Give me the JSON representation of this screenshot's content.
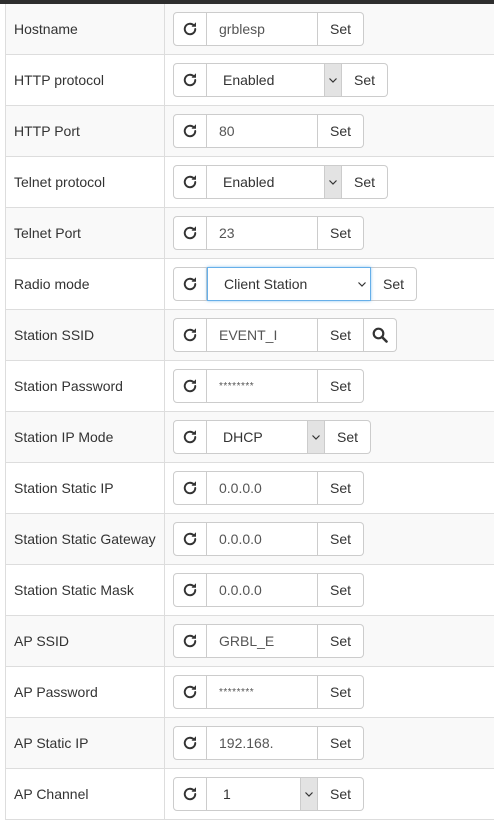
{
  "rows": [
    {
      "label": "Hostname",
      "type": "text",
      "value": "grblesp",
      "set": "Set"
    },
    {
      "label": "HTTP protocol",
      "type": "select",
      "value": "Enabled",
      "set": "Set"
    },
    {
      "label": "HTTP Port",
      "type": "text",
      "value": "80",
      "set": "Set"
    },
    {
      "label": "Telnet protocol",
      "type": "select",
      "value": "Enabled",
      "set": "Set"
    },
    {
      "label": "Telnet Port",
      "type": "text",
      "value": "23",
      "set": "Set"
    },
    {
      "label": "Radio mode",
      "type": "select",
      "value": "Client Station",
      "set": "Set"
    },
    {
      "label": "Station SSID",
      "type": "text",
      "value": "EVENT_I",
      "set": "Set"
    },
    {
      "label": "Station Password",
      "type": "password",
      "value": "********",
      "set": "Set"
    },
    {
      "label": "Station IP Mode",
      "type": "select",
      "value": "DHCP",
      "set": "Set"
    },
    {
      "label": "Station Static IP",
      "type": "text",
      "value": "0.0.0.0",
      "set": "Set"
    },
    {
      "label": "Station Static Gateway",
      "type": "text",
      "value": "0.0.0.0",
      "set": "Set"
    },
    {
      "label": "Station Static Mask",
      "type": "text",
      "value": "0.0.0.0",
      "set": "Set"
    },
    {
      "label": "AP SSID",
      "type": "text",
      "value": "GRBL_E",
      "set": "Set"
    },
    {
      "label": "AP Password",
      "type": "password",
      "value": "********",
      "set": "Set"
    },
    {
      "label": "AP Static IP",
      "type": "text",
      "value": "192.168.",
      "set": "Set"
    },
    {
      "label": "AP Channel",
      "type": "select",
      "value": "1",
      "set": "Set"
    }
  ],
  "icons": {
    "refresh": "refresh-icon",
    "search": "search-icon",
    "dropdown": "chevron-down-icon"
  },
  "colors": {
    "focus_border": "#66afe9",
    "row_stripe": "#f9f9f9",
    "border": "#cccccc",
    "topbar": "#2e2e2e"
  }
}
